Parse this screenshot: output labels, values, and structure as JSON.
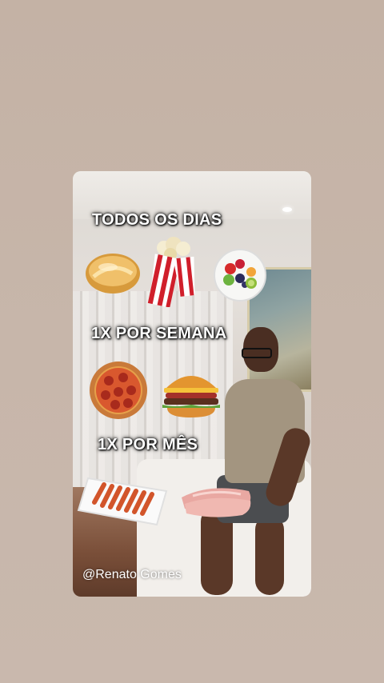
{
  "story": {
    "sections": [
      {
        "label": "TODOS OS DIAS",
        "foods": [
          "bread-roll",
          "popcorn",
          "fruit-salad"
        ]
      },
      {
        "label": "1X POR SEMANA",
        "foods": [
          "pizza",
          "hamburger"
        ]
      },
      {
        "label": "1X POR MÊS",
        "foods": [
          "sausage-tray",
          "ham-slices"
        ]
      }
    ],
    "watermark": "@Renato Gomes"
  }
}
